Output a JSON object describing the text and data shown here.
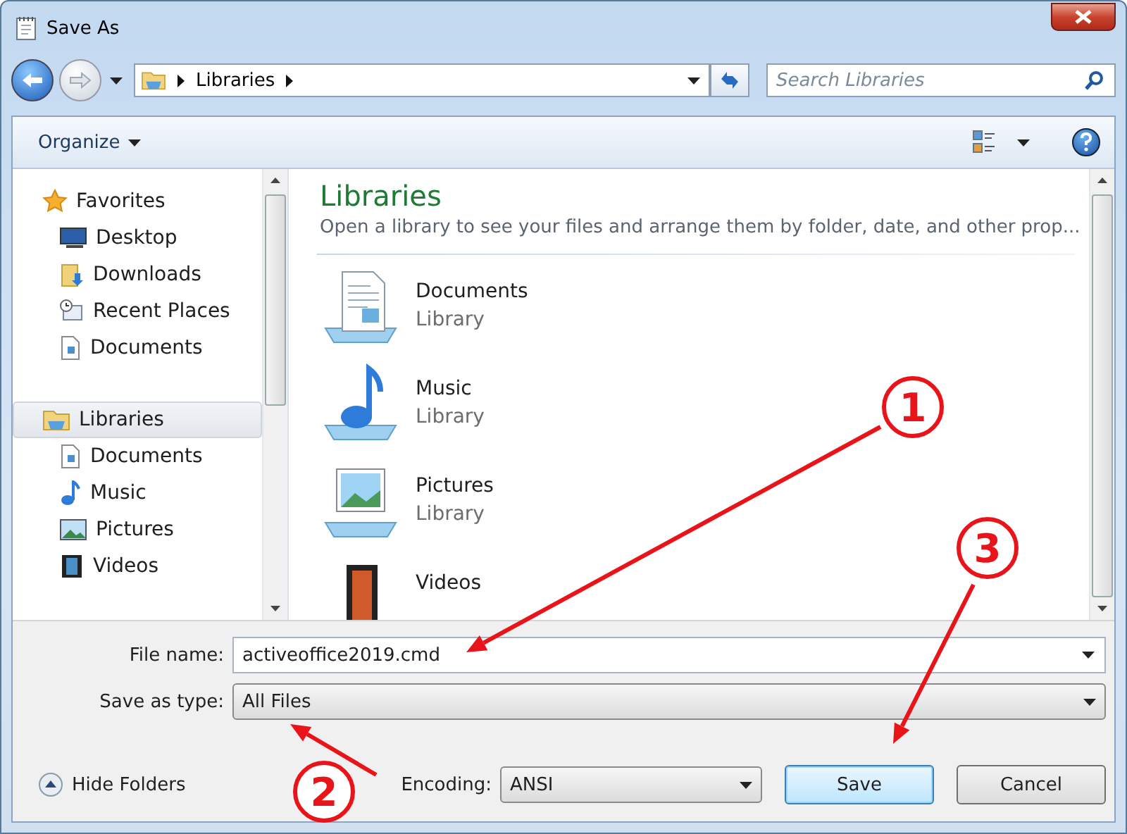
{
  "window": {
    "title": "Save As"
  },
  "address_bar": {
    "path": [
      "Libraries"
    ]
  },
  "search": {
    "placeholder": "Search Libraries"
  },
  "toolbar": {
    "organize": "Organize"
  },
  "sidebar": {
    "groups": [
      {
        "label": "Favorites",
        "selected": false,
        "children": [
          {
            "label": "Desktop",
            "selected": false
          },
          {
            "label": "Downloads",
            "selected": false
          },
          {
            "label": "Recent Places",
            "selected": false
          },
          {
            "label": "Documents",
            "selected": false
          }
        ]
      },
      {
        "label": "Libraries",
        "selected": true,
        "children": [
          {
            "label": "Documents",
            "selected": false
          },
          {
            "label": "Music",
            "selected": false
          },
          {
            "label": "Pictures",
            "selected": false
          },
          {
            "label": "Videos",
            "selected": false
          }
        ]
      }
    ]
  },
  "content": {
    "heading": "Libraries",
    "description": "Open a library to see your files and arrange them by folder, date, and other prop...",
    "items": [
      {
        "name": "Documents",
        "type": "Library"
      },
      {
        "name": "Music",
        "type": "Library"
      },
      {
        "name": "Pictures",
        "type": "Library"
      },
      {
        "name": "Videos"
      }
    ]
  },
  "form": {
    "file_name": {
      "label": "File name:",
      "value": "activeoffice2019.cmd"
    },
    "save_as_type": {
      "label": "Save as type:",
      "value": "All Files"
    },
    "encoding": {
      "label": "Encoding:",
      "value": "ANSI"
    }
  },
  "buttons": {
    "hide_folders": "Hide Folders",
    "save": "Save",
    "cancel": "Cancel"
  },
  "annotations": [
    {
      "label": "1"
    },
    {
      "label": "2"
    },
    {
      "label": "3"
    }
  ]
}
